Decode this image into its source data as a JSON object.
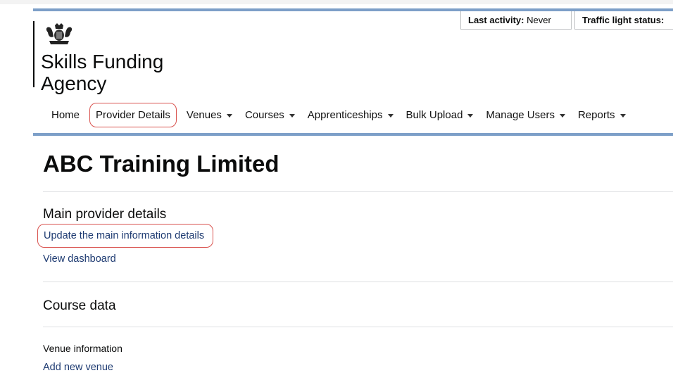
{
  "status": {
    "last_activity_label": "Last activity:",
    "last_activity_value": "Never",
    "traffic_light_label": "Traffic light status:"
  },
  "brand": {
    "name_line1": "Skills Funding",
    "name_line2": "Agency",
    "logo_icon": "royal-crest-icon"
  },
  "nav": {
    "items": [
      {
        "label": "Home",
        "dropdown": false
      },
      {
        "label": "Provider Details",
        "dropdown": false,
        "highlighted": true
      },
      {
        "label": "Venues",
        "dropdown": true
      },
      {
        "label": "Courses",
        "dropdown": true
      },
      {
        "label": "Apprenticeships",
        "dropdown": true
      },
      {
        "label": "Bulk Upload",
        "dropdown": true
      },
      {
        "label": "Manage Users",
        "dropdown": true
      },
      {
        "label": "Reports",
        "dropdown": true
      }
    ]
  },
  "main": {
    "title": "ABC Training Limited",
    "provider_section": {
      "heading": "Main provider details",
      "update_link": "Update the main information details",
      "dashboard_link": "View dashboard"
    },
    "course_section": {
      "heading": "Course data"
    },
    "venue_section": {
      "heading": "Venue information",
      "add_link": "Add new venue"
    }
  },
  "colors": {
    "accent_rule": "#7d9fc8",
    "highlight_outline": "#d9534f",
    "link": "#1d3a71"
  }
}
